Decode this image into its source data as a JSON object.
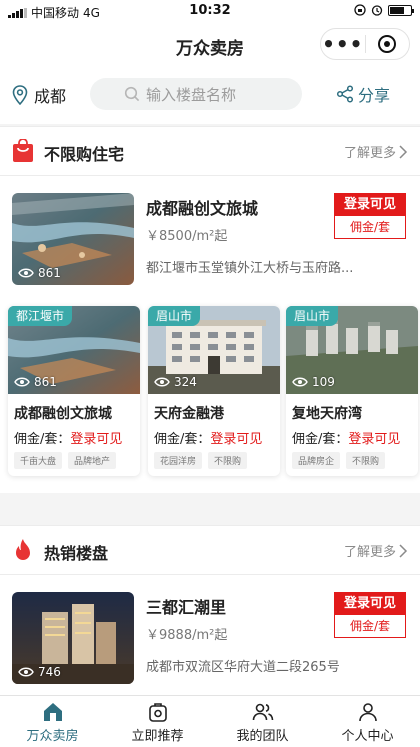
{
  "status_bar": {
    "carrier": "中国移动",
    "network": "4G",
    "time": "10:32"
  },
  "app": {
    "title": "万众卖房",
    "capsule_more": "•••"
  },
  "search": {
    "city": "成都",
    "placeholder": "输入楼盘名称",
    "share_label": "分享"
  },
  "colors": {
    "accent": "#2e6e80",
    "badge_red": "#e21a1a",
    "region_tag": "#3aa9a9"
  },
  "section_unlimited": {
    "title": "不限购住宅",
    "more": "了解更多",
    "featured": {
      "name": "成都融创文旅城",
      "price": "￥8500/m²起",
      "address": "都江堰市玉堂镇外江大桥与玉府路...",
      "views": "861",
      "badge_top": "登录可见",
      "badge_bottom": "佣金/套"
    },
    "cards": [
      {
        "region": "都江堰市",
        "name": "成都融创文旅城",
        "views": "861",
        "commission_label": "佣金/套：",
        "commission_value": "登录可见",
        "tags": [
          "千亩大盘",
          "品牌地产"
        ]
      },
      {
        "region": "眉山市",
        "name": "天府金融港",
        "views": "324",
        "commission_label": "佣金/套：",
        "commission_value": "登录可见",
        "tags": [
          "花园洋房",
          "不限购"
        ]
      },
      {
        "region": "眉山市",
        "name": "复地天府湾",
        "views": "109",
        "commission_label": "佣金/套：",
        "commission_value": "登录可见",
        "tags": [
          "品牌房企",
          "不限购"
        ]
      }
    ]
  },
  "section_hot": {
    "title": "热销楼盘",
    "more": "了解更多",
    "featured": {
      "name": "三都汇潮里",
      "price": "￥9888/m²起",
      "address": "成都市双流区华府大道二段265号",
      "views": "746",
      "badge_top": "登录可见",
      "badge_bottom": "佣金/套"
    }
  },
  "tabbar": [
    {
      "label": "万众卖房",
      "icon": "home-icon",
      "active": true
    },
    {
      "label": "立即推荐",
      "icon": "recommend-icon",
      "active": false
    },
    {
      "label": "我的团队",
      "icon": "team-icon",
      "active": false
    },
    {
      "label": "个人中心",
      "icon": "person-icon",
      "active": false
    }
  ]
}
